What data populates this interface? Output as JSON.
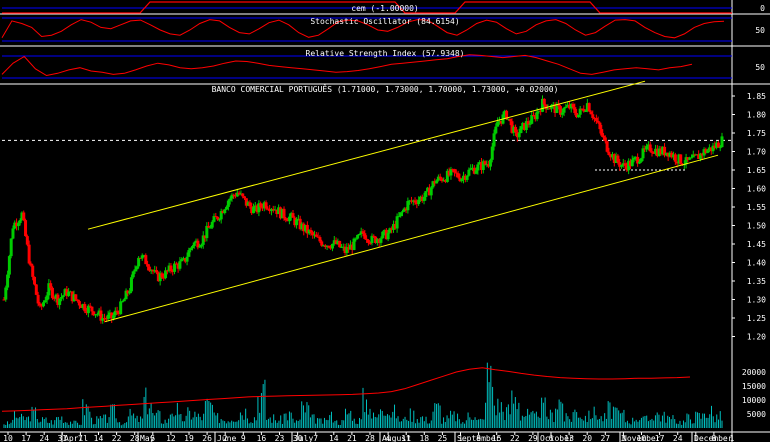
{
  "panels": {
    "cem": {
      "title": "cem  (-1.00000)",
      "axis_label": "0"
    },
    "stochastic": {
      "title": "Stochastic Oscillator (84.6154)",
      "axis_label": "50"
    },
    "rsi": {
      "title": "Relative Strength Index (57.9348)",
      "axis_label": "50"
    },
    "price": {
      "title": "BANCO COMERCIAL PORTUGUÊS (1.71000, 1.73000, 1.70000, 1.73000, +0.02000)"
    }
  },
  "colors": {
    "background": "#000000",
    "bull": "#00cc00",
    "bear": "#ff0000",
    "trend": "#ffff00",
    "indicator": "#ff0000",
    "guide": "#0000ff",
    "grid": "#ffffff",
    "volume": "#00c0c0"
  },
  "chart_data": {
    "type": "candlestick",
    "last_ohlc": {
      "open": 1.71,
      "high": 1.73,
      "low": 1.7,
      "close": 1.73,
      "change": 0.02
    },
    "price_axis": {
      "min": 1.15,
      "max": 1.85,
      "ticks": [
        "1.85",
        "1.80",
        "1.75",
        "1.70",
        "1.65",
        "1.60",
        "1.55",
        "1.50",
        "1.45",
        "1.40",
        "1.35",
        "1.30",
        "1.25",
        "1.20"
      ]
    },
    "volume_axis": {
      "ticks": [
        "20000",
        "15000",
        "10000",
        "5000"
      ]
    },
    "day_labels": [
      "10",
      "17",
      "24",
      "31",
      "7",
      "14",
      "22",
      "28",
      "5",
      "12",
      "19",
      "26",
      "2",
      "9",
      "16",
      "23",
      "30",
      "7",
      "14",
      "21",
      "28",
      "4",
      "11",
      "18",
      "25",
      "1",
      "8",
      "15",
      "22",
      "29",
      "6",
      "13",
      "20",
      "27",
      "3",
      "10",
      "17",
      "24",
      "1",
      "8",
      "1"
    ],
    "month_labels": [
      "April",
      "May",
      "June",
      "July",
      "August",
      "September",
      "October",
      "November",
      "December"
    ],
    "price_path": [
      1.3,
      1.5,
      1.53,
      1.38,
      1.27,
      1.33,
      1.3,
      1.32,
      1.3,
      1.28,
      1.27,
      1.25,
      1.25,
      1.28,
      1.33,
      1.42,
      1.4,
      1.36,
      1.37,
      1.39,
      1.4,
      1.45,
      1.46,
      1.5,
      1.53,
      1.57,
      1.59,
      1.56,
      1.54,
      1.56,
      1.55,
      1.53,
      1.52,
      1.5,
      1.48,
      1.46,
      1.45,
      1.45,
      1.43,
      1.45,
      1.48,
      1.46,
      1.47,
      1.48,
      1.52,
      1.56,
      1.57,
      1.58,
      1.62,
      1.63,
      1.64,
      1.63,
      1.65,
      1.66,
      1.67,
      1.78,
      1.8,
      1.74,
      1.77,
      1.79,
      1.83,
      1.82,
      1.81,
      1.82,
      1.8,
      1.83,
      1.78,
      1.72,
      1.68,
      1.66,
      1.67,
      1.69,
      1.71,
      1.7,
      1.7,
      1.68,
      1.67,
      1.68,
      1.7,
      1.71,
      1.73
    ],
    "trend_channel": {
      "upper": [
        [
          0,
          1.49
        ],
        [
          1,
          1.89
        ]
      ],
      "lower": [
        [
          0,
          1.24
        ],
        [
          1,
          1.69
        ]
      ]
    },
    "resistance": 1.73,
    "support": 1.65,
    "volume_values": [
      2000,
      5000,
      4200,
      6500,
      3500,
      2800,
      4800,
      3000,
      2200,
      9000,
      3500,
      4000,
      7000,
      2500,
      5600,
      3800,
      12000,
      5500,
      3300,
      8000,
      4200,
      6300,
      5000,
      10000,
      4500,
      3900,
      5200,
      7600,
      4700,
      15000,
      4400,
      3600,
      5900,
      3100,
      8600,
      4100,
      2900,
      5200,
      2700,
      6800,
      3500,
      12000,
      5000,
      11000,
      7000,
      3700,
      6000,
      4800,
      3600,
      8800,
      4000,
      5300,
      2600,
      6900,
      3300,
      22000,
      10000,
      7500,
      13000,
      6000,
      5000,
      9000,
      5700,
      12000,
      4300,
      7300,
      5100,
      6600,
      4500,
      8200,
      5800,
      3400,
      4800,
      3700,
      6300,
      5100,
      3800,
      2800,
      4500,
      5200,
      7300,
      5000,
      4400
    ],
    "volume_ma": [
      6000,
      6100,
      6300,
      6500,
      6700,
      6900,
      7200,
      7500,
      7800,
      8100,
      8400,
      8700,
      9000,
      9300,
      9600,
      9900,
      10200,
      10500,
      10800,
      11100,
      11300,
      11400,
      11500,
      11600,
      11700,
      11800,
      11900,
      12000,
      12200,
      12500,
      13000,
      14000,
      15500,
      17000,
      18500,
      20000,
      21000,
      21500,
      20800,
      20200,
      19500,
      18900,
      18400,
      18000,
      17800,
      17600,
      17500,
      17500,
      17600,
      17800,
      17800,
      17900,
      18000,
      18200
    ],
    "stochastic_series": [
      20,
      85,
      75,
      60,
      25,
      30,
      45,
      70,
      90,
      80,
      60,
      55,
      70,
      85,
      88,
      70,
      50,
      35,
      30,
      50,
      75,
      90,
      85,
      60,
      40,
      35,
      55,
      78,
      88,
      70,
      40,
      22,
      30,
      55,
      82,
      88,
      85,
      70,
      50,
      45,
      60,
      80,
      90,
      88,
      65,
      40,
      30,
      50,
      75,
      88,
      80,
      55,
      35,
      45,
      70,
      85,
      90,
      75,
      50,
      30,
      40,
      65,
      88,
      90,
      85,
      60,
      40,
      25,
      20,
      35,
      60,
      75,
      82,
      84
    ],
    "rsi_series": [
      40,
      60,
      72,
      50,
      38,
      42,
      48,
      52,
      46,
      44,
      40,
      42,
      48,
      55,
      60,
      57,
      52,
      50,
      52,
      55,
      60,
      64,
      63,
      60,
      56,
      54,
      52,
      50,
      48,
      46,
      44,
      45,
      47,
      50,
      54,
      58,
      60,
      62,
      64,
      66,
      68,
      72,
      75,
      74,
      72,
      70,
      72,
      74,
      70,
      64,
      58,
      50,
      42,
      40,
      44,
      48,
      50,
      52,
      50,
      48,
      52,
      54,
      58
    ]
  }
}
